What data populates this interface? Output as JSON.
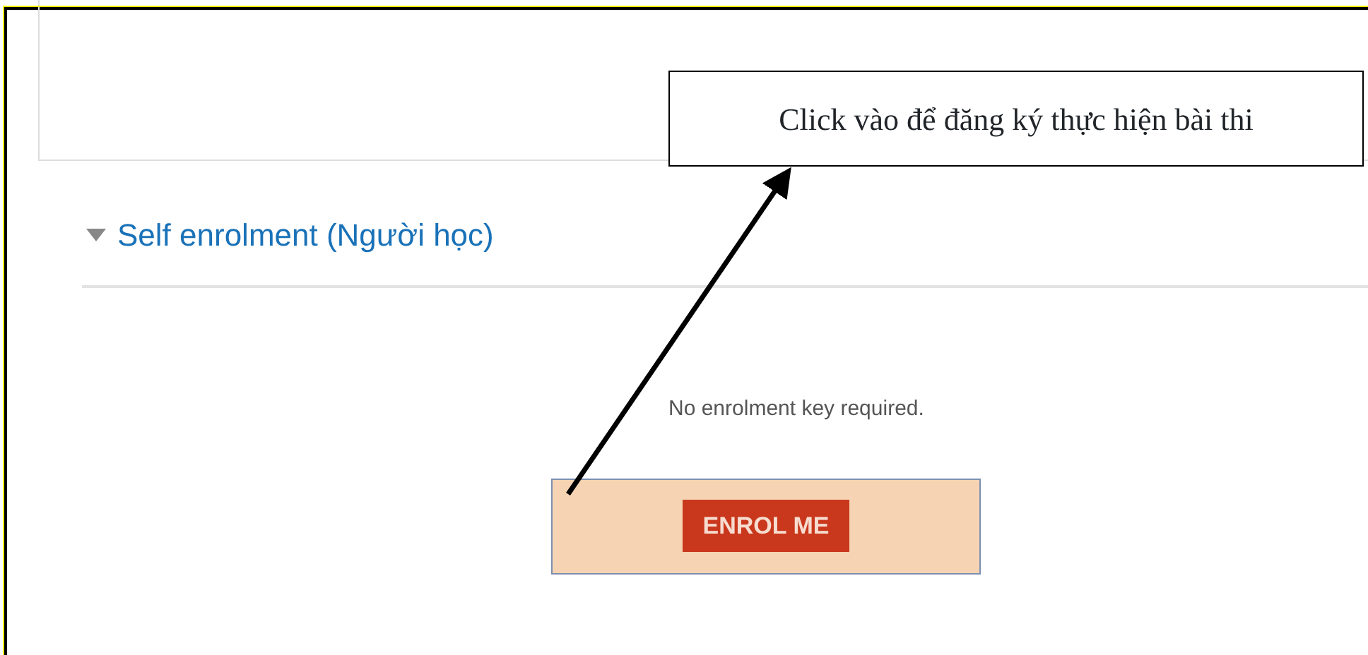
{
  "callout": {
    "text": "Click vào để đăng ký thực hiện bài thi"
  },
  "section": {
    "title": "Self enrolment (Người học)",
    "expanded": true
  },
  "note": "No enrolment key required.",
  "button": {
    "label": "ENROL ME"
  }
}
